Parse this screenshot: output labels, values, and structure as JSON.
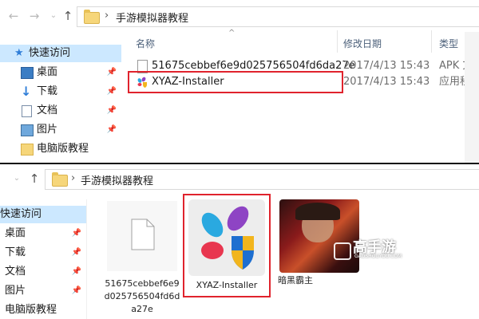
{
  "top_window": {
    "breadcrumb": [
      "手游模拟器教程"
    ],
    "sidebar": {
      "items": [
        {
          "label": "快速访问",
          "icon": "star-icon"
        },
        {
          "label": "桌面",
          "icon": "desktop-icon",
          "pinned": true
        },
        {
          "label": "下载",
          "icon": "download-arrow-icon",
          "pinned": true
        },
        {
          "label": "文档",
          "icon": "document-icon",
          "pinned": true
        },
        {
          "label": "图片",
          "icon": "picture-icon",
          "pinned": true
        },
        {
          "label": "电脑版教程",
          "icon": "folder-icon"
        }
      ]
    },
    "columns": {
      "name": "名称",
      "date": "修改日期",
      "type": "类型"
    },
    "files": [
      {
        "name": "51675cebbef6e9d025756504fd6da27e",
        "date": "2017/4/13 15:43",
        "type": "APK 文件",
        "icon": "blank-file-icon"
      },
      {
        "name": "XYAZ-Installer",
        "date": "2017/4/13 15:43",
        "type": "应用程序",
        "icon": "xyaz-installer-icon",
        "highlighted": true
      }
    ]
  },
  "bottom_window": {
    "breadcrumb": [
      "手游模拟器教程"
    ],
    "sidebar": {
      "items": [
        {
          "label": "快速访问",
          "selected": true
        },
        {
          "label": "桌面",
          "pinned": true
        },
        {
          "label": "下载",
          "pinned": true
        },
        {
          "label": "文档",
          "pinned": true
        },
        {
          "label": "图片",
          "pinned": true
        },
        {
          "label": "电脑版教程"
        }
      ]
    },
    "tiles": [
      {
        "label": "51675cebbef6e9d025756504fd6da27e",
        "icon": "blank-file-icon"
      },
      {
        "label": "XYAZ-Installer",
        "icon": "xyaz-installer-icon",
        "highlighted": true
      },
      {
        "label": "暗黑霸主",
        "icon": "game-cover-icon"
      }
    ],
    "watermark": {
      "text": "高手游",
      "subtext": "GAOSHOUYOU.COM"
    }
  },
  "colors": {
    "highlight": "#e0232d",
    "selection": "#cce8ff",
    "folder": "#f6d67a"
  }
}
